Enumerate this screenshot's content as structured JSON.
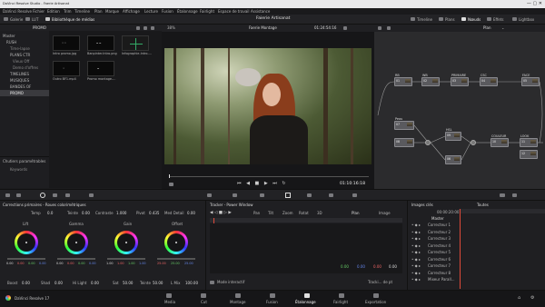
{
  "window": {
    "title": "DaVinci Resolve Studio - Faerie Artisanat"
  },
  "menu": [
    "DaVinci Resolve",
    "Fichier",
    "Edition",
    "Trim",
    "Timeline",
    "Plan",
    "Marque",
    "Affichage",
    "Lecture",
    "Fusion",
    "Étalonnage",
    "Fairlight",
    "Espace de travail",
    "Assistance"
  ],
  "toolbar": {
    "gallery": "Galerie",
    "lut": "LUT",
    "media_library": "Bibliothèque de médias",
    "project": "Faierie Artisanat",
    "timeline": "Timeline",
    "plans": "Plans",
    "nodes": "Nœuds",
    "effects": "Effets",
    "lightbox": "Lightbox"
  },
  "media": {
    "bin": "PROMO",
    "sidebar": [
      "Master",
      "RUSH",
      "Time-lapse",
      "PLANS CTR",
      "Vieux Off",
      "Demo d'offres",
      "TIMELINES",
      "MUSIQUES",
      "BANDES OF",
      "PROMO"
    ],
    "smart_bins": "Chutiers paramétrables",
    "keywords": "Keywords",
    "clips": [
      {
        "name": "Intro promo.jpg"
      },
      {
        "name": "Banpinter.Intro.png"
      },
      {
        "name": "Infographie-Intro-..."
      },
      {
        "name": "Outro BF1.mp4"
      },
      {
        "name": "Promo montage-..."
      }
    ]
  },
  "viewer": {
    "zoom": "38%",
    "timeline": "Faerie Montage",
    "timecode": "01:24:54:16",
    "transport_tc": "01:10:16:18"
  },
  "nodes": {
    "mode": "Plan",
    "items": [
      {
        "label": "RB",
        "num": "01"
      },
      {
        "label": "WB",
        "num": "02"
      },
      {
        "label": "PRIMAIRE",
        "num": "03"
      },
      {
        "label": "CSC",
        "num": "04"
      },
      {
        "label": "FACE",
        "num": "05"
      },
      {
        "label": "Peau",
        "num": "07"
      },
      {
        "label": "HSL",
        "num": "09"
      },
      {
        "label": "COULEUR",
        "num": "10"
      },
      {
        "label": "LOOK",
        "num": "11"
      },
      {
        "label": "",
        "num": "08"
      },
      {
        "label": "",
        "num": "06"
      },
      {
        "label": "",
        "num": "12"
      }
    ]
  },
  "color": {
    "title": "Corrections primaires - Roues colorimétriques",
    "top": [
      {
        "label": "Temp",
        "value": "0.0"
      },
      {
        "label": "Teinte",
        "value": "0.00"
      },
      {
        "label": "Contraste",
        "value": "1.000"
      },
      {
        "label": "Pivot",
        "value": "0.435"
      },
      {
        "label": "Med Detail",
        "value": "0.00"
      }
    ],
    "wheels": [
      {
        "name": "Lift",
        "values": [
          "0.00",
          "0.00",
          "0.00",
          "0.00"
        ]
      },
      {
        "name": "Gamma",
        "values": [
          "0.00",
          "0.00",
          "0.00",
          "0.00"
        ]
      },
      {
        "name": "Gain",
        "values": [
          "1.00",
          "1.00",
          "1.00",
          "1.00"
        ]
      },
      {
        "name": "Offset",
        "values": [
          "25.00",
          "25.00",
          "25.00",
          ""
        ]
      }
    ],
    "bottom": [
      {
        "label": "Boost",
        "value": "0.00"
      },
      {
        "label": "Shad",
        "value": "0.00"
      },
      {
        "label": "Hi Light",
        "value": "0.00"
      },
      {
        "label": "Sat",
        "value": "50.00"
      },
      {
        "label": "Teinte",
        "value": "50.00"
      },
      {
        "label": "L Mix",
        "value": "100.00"
      }
    ]
  },
  "tracker": {
    "title": "Tracker - Power Window",
    "fields": [
      "Pan",
      "Tilt",
      "Zoom",
      "Rotat",
      "3D"
    ],
    "tabs": [
      "Plan",
      "Image"
    ],
    "values": [
      "0.00",
      "0.00",
      "0.00",
      "0.00"
    ],
    "interactive": "Mode interactif",
    "tracking": "Tracki... de pt"
  },
  "clips": {
    "title": "Images clés",
    "timecode": "00:00:20:00",
    "mode": "Toutes",
    "master": "Master",
    "rows": [
      "Correcteur 1",
      "Correcteur 2",
      "Correcteur 3",
      "Correcteur 4",
      "Correcteur 5",
      "Correcteur 6",
      "Correcteur 7",
      "Correcteur 8",
      "Mixeur Parall..."
    ]
  },
  "pages": [
    "Media",
    "Cut",
    "Montage",
    "Fusion",
    "Étalonnage",
    "Fairlight",
    "Exportation"
  ],
  "active_page": "Étalonnage",
  "app_name": "DaVinci Resolve 17"
}
